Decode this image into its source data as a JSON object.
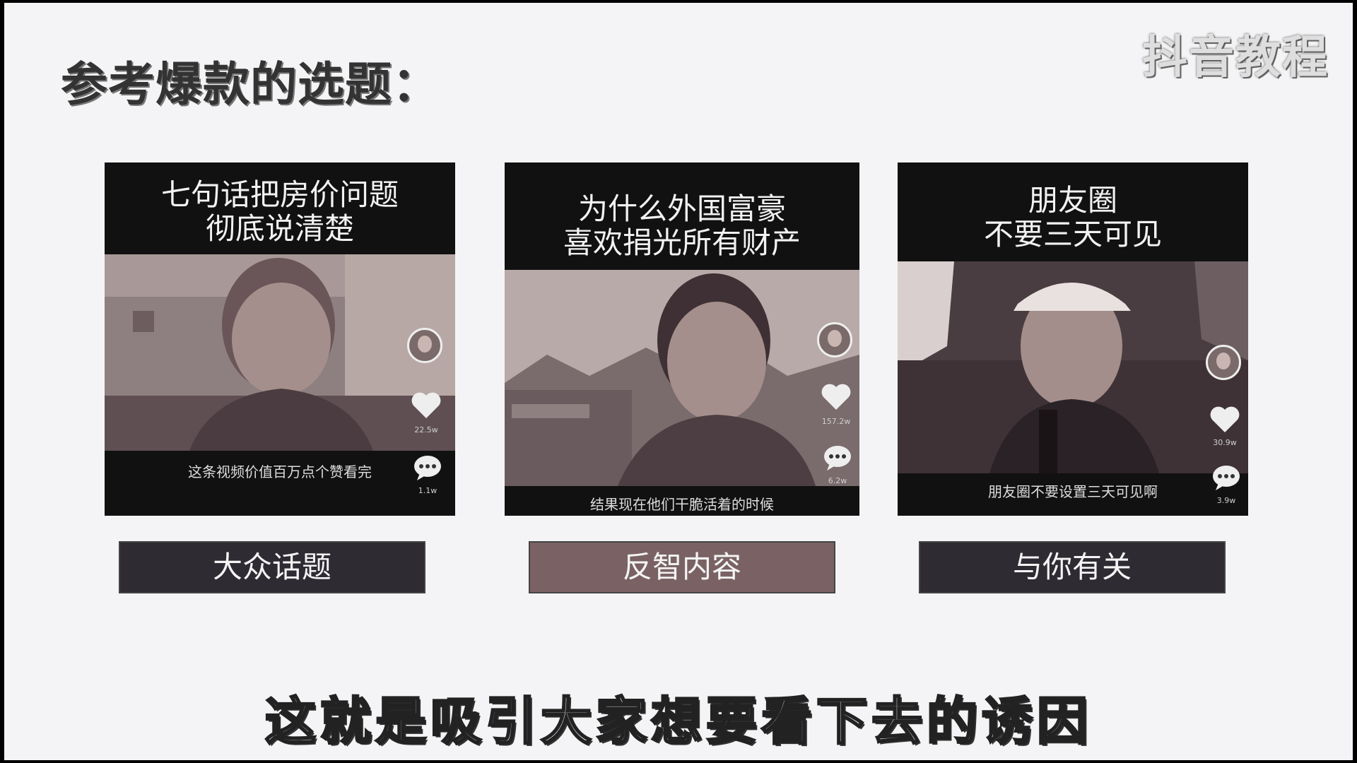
{
  "page": {
    "title": "参考爆款的选题：",
    "watermark": "抖音教程",
    "bottom_subtitle": "这就是吸引大家想要看下去的诱因"
  },
  "cards": [
    {
      "caption": "七句话把房价问题\n彻底说清楚",
      "subtitle": "这条视频价值百万点个赞看完",
      "likes": "22.5w",
      "comments": "1.1w"
    },
    {
      "caption": "为什么外国富豪\n喜欢捐光所有财产",
      "subtitle": "结果现在他们干脆活着的时候",
      "likes": "157.2w",
      "comments": "6.2w"
    },
    {
      "caption": "朋友圈\n不要三天可见",
      "subtitle": "朋友圈不要设置三天可见啊",
      "likes": "30.9w",
      "comments": "3.9w"
    }
  ],
  "tags": [
    {
      "label": "大众话题",
      "color": "#2f2b33"
    },
    {
      "label": "反智内容",
      "color": "#7a6264"
    },
    {
      "label": "与你有关",
      "color": "#2f2b33"
    }
  ],
  "icons": {
    "heart": "heart-icon",
    "comment": "comment-icon",
    "avatar": "avatar"
  }
}
